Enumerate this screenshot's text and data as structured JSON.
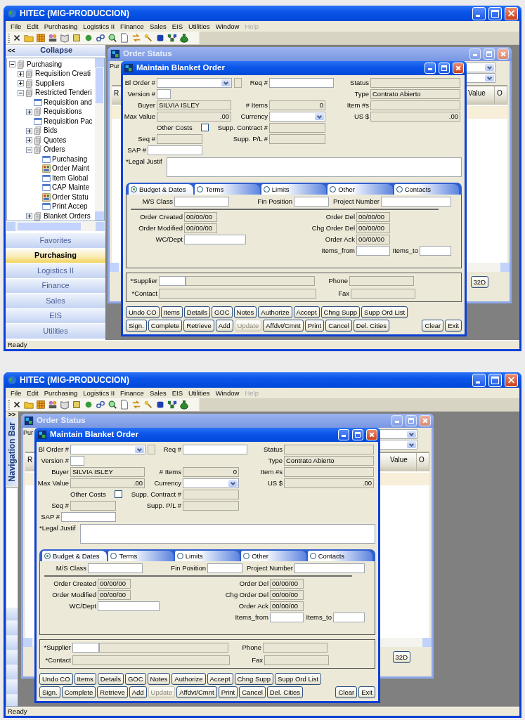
{
  "screenshots": [
    {
      "window": {
        "title": "HITEC  (MIG-PRODUCCION)"
      },
      "menu": [
        {
          "label": "File",
          "disabled": false
        },
        {
          "label": "Edit",
          "disabled": false
        },
        {
          "label": "Purchasing",
          "disabled": false
        },
        {
          "label": "Logistics II",
          "disabled": false
        },
        {
          "label": "Finance",
          "disabled": false
        },
        {
          "label": "Sales",
          "disabled": false
        },
        {
          "label": "EIS",
          "disabled": false
        },
        {
          "label": "Utilities",
          "disabled": false
        },
        {
          "label": "Window",
          "disabled": false
        },
        {
          "label": "Help",
          "disabled": true
        }
      ],
      "sidebar": {
        "collapsed": false,
        "toggle": "<<",
        "title": "Collapse",
        "tree": [
          {
            "label": "Purchasing",
            "kind": "folder",
            "expanded": true,
            "children": [
              {
                "label": "Requisition Creati",
                "kind": "folder",
                "expanded": false
              },
              {
                "label": "Suppliers",
                "kind": "folder",
                "expanded": false
              },
              {
                "label": "Restricted Tenderi",
                "kind": "folder",
                "expanded": true,
                "children": [
                  {
                    "label": "Requisition and",
                    "kind": "form"
                  },
                  {
                    "label": "Requisitions",
                    "kind": "folder",
                    "expanded": false
                  },
                  {
                    "label": "Requisition Pac",
                    "kind": "form"
                  },
                  {
                    "label": "Bids",
                    "kind": "folder",
                    "expanded": false
                  },
                  {
                    "label": "Quotes",
                    "kind": "folder",
                    "expanded": false
                  },
                  {
                    "label": "Orders",
                    "kind": "folder",
                    "expanded": true,
                    "children": [
                      {
                        "label": "Purchasing",
                        "kind": "form"
                      },
                      {
                        "label": "Order Maint",
                        "kind": "report"
                      },
                      {
                        "label": "Item Global",
                        "kind": "form"
                      },
                      {
                        "label": "CAP Mainte",
                        "kind": "form"
                      },
                      {
                        "label": "Order Statu",
                        "kind": "report"
                      },
                      {
                        "label": "Print Accep",
                        "kind": "form"
                      }
                    ]
                  },
                  {
                    "label": "Blanket Orders",
                    "kind": "folder",
                    "expanded": false
                  }
                ]
              }
            ]
          }
        ],
        "nav_buttons": [
          {
            "label": "Favorites",
            "selected": false
          },
          {
            "label": "Purchasing",
            "selected": true
          },
          {
            "label": "Logistics II",
            "selected": false
          },
          {
            "label": "Finance",
            "selected": false
          },
          {
            "label": "Sales",
            "selected": false
          },
          {
            "label": "EIS",
            "selected": false
          },
          {
            "label": "Utilities",
            "selected": false
          }
        ]
      },
      "order_status": {
        "title": "Order Status",
        "filter_label": "Pur",
        "columns": [
          "R",
          "Value",
          "O"
        ],
        "button": "32D"
      },
      "dialog": {
        "title": "Maintain Blanket Order",
        "fields": [
          {
            "label": "Bl Order #",
            "kind": "dropdown"
          },
          {
            "label": "Req #",
            "kind": "input"
          },
          {
            "label": "Status",
            "kind": "readonly"
          },
          {
            "label": "Version #",
            "kind": "input"
          },
          {
            "label": "Type",
            "kind": "readonly",
            "value": "Contrato Abierto"
          },
          {
            "label": "Buyer",
            "kind": "readonly",
            "value": "SILVIA  ISLEY"
          },
          {
            "label": "# Items",
            "kind": "number",
            "value": "0"
          },
          {
            "label": "Item #s",
            "kind": "readonly"
          },
          {
            "label": "Max Value",
            "kind": "number",
            "value": ".00"
          },
          {
            "label": "Currency",
            "kind": "dropdown"
          },
          {
            "label": "US $",
            "kind": "number",
            "value": ".00"
          },
          {
            "label": "Other Costs",
            "kind": "checkbox",
            "checked": false
          },
          {
            "label": "Supp. Contract #",
            "kind": "readonly"
          },
          {
            "label": "Seq #",
            "kind": "readonly"
          },
          {
            "label": "Supp. P/L #",
            "kind": "readonly"
          },
          {
            "label": "SAP #",
            "kind": "input"
          },
          {
            "label": "*Legal Justif",
            "kind": "textarea"
          }
        ],
        "tabs": [
          {
            "label": "Budget & Dates",
            "selected": true
          },
          {
            "label": "Terms",
            "selected": false
          },
          {
            "label": "Limits",
            "selected": false
          },
          {
            "label": "Other",
            "selected": false
          },
          {
            "label": "Contacts",
            "selected": false
          }
        ],
        "tab_fields": [
          {
            "label": "M/S Class",
            "kind": "input"
          },
          {
            "label": "Fin Position",
            "kind": "input"
          },
          {
            "label": "Project Number",
            "kind": "input"
          },
          {
            "label": "Order Created",
            "kind": "readonly",
            "value": "00/00/00"
          },
          {
            "label": "Order Del",
            "kind": "readonly",
            "value": "00/00/00"
          },
          {
            "label": "Order Modified",
            "kind": "readonly",
            "value": "00/00/00"
          },
          {
            "label": "Chg Order Del",
            "kind": "readonly",
            "value": "00/00/00"
          },
          {
            "label": "WC/Dept",
            "kind": "input"
          },
          {
            "label": "Order Ack",
            "kind": "readonly",
            "value": "00/00/00"
          },
          {
            "label": "Items_from",
            "kind": "input"
          },
          {
            "label": "Items_to",
            "kind": "input"
          }
        ],
        "supplier_fields": [
          {
            "label": "*Supplier",
            "kind": "lookup"
          },
          {
            "label": "Phone",
            "kind": "readonly"
          },
          {
            "label": "*Contact",
            "kind": "readonly"
          },
          {
            "label": "Fax",
            "kind": "readonly"
          }
        ],
        "button_rows": [
          [
            {
              "label": "Undo CO",
              "disabled": false
            },
            {
              "label": "Items",
              "disabled": false
            },
            {
              "label": "Details",
              "disabled": false
            },
            {
              "label": "GOC",
              "disabled": false
            },
            {
              "label": "Notes",
              "disabled": false
            },
            {
              "label": "Authorize",
              "disabled": false
            },
            {
              "label": "Accept",
              "disabled": false
            },
            {
              "label": "Chng Supp",
              "disabled": false
            },
            {
              "label": "Supp Ord List",
              "disabled": false
            }
          ],
          [
            {
              "label": "Sign.",
              "disabled": false
            },
            {
              "label": "Complete",
              "disabled": false
            },
            {
              "label": "Retrieve",
              "disabled": false
            },
            {
              "label": "Add",
              "disabled": false
            },
            {
              "label": "Update",
              "disabled": true
            },
            {
              "label": "Affdvt/Cmnt",
              "disabled": false
            },
            {
              "label": "Print",
              "disabled": false
            },
            {
              "label": "Cancel",
              "disabled": false
            },
            {
              "label": "Del. Cities",
              "disabled": false
            }
          ]
        ],
        "end_buttons": [
          {
            "label": "Clear",
            "disabled": false
          },
          {
            "label": "Exit",
            "disabled": false
          }
        ]
      },
      "status_bar": "Ready"
    },
    {
      "window": {
        "title": "HITEC  (MIG-PRODUCCION)"
      },
      "menu": [
        {
          "label": "File",
          "disabled": false
        },
        {
          "label": "Edit",
          "disabled": false
        },
        {
          "label": "Purchasing",
          "disabled": false
        },
        {
          "label": "Logistics II",
          "disabled": false
        },
        {
          "label": "Finance",
          "disabled": false
        },
        {
          "label": "Sales",
          "disabled": false
        },
        {
          "label": "EIS",
          "disabled": false
        },
        {
          "label": "Utilities",
          "disabled": false
        },
        {
          "label": "Window",
          "disabled": false
        },
        {
          "label": "Help",
          "disabled": true
        }
      ],
      "sidebar": {
        "collapsed": true,
        "toggle": ">>",
        "title": "Navigation Bar"
      },
      "order_status": {
        "title": "Order Status",
        "filter_label": "Pur",
        "columns": [
          "R",
          "Value",
          "O"
        ],
        "button": "32D"
      },
      "dialog": {
        "title": "Maintain Blanket Order",
        "fields": [
          {
            "label": "Bl Order #",
            "kind": "dropdown"
          },
          {
            "label": "Req #",
            "kind": "input"
          },
          {
            "label": "Status",
            "kind": "readonly"
          },
          {
            "label": "Version #",
            "kind": "input"
          },
          {
            "label": "Type",
            "kind": "readonly",
            "value": "Contrato Abierto"
          },
          {
            "label": "Buyer",
            "kind": "readonly",
            "value": "SILVIA  ISLEY"
          },
          {
            "label": "# Items",
            "kind": "number",
            "value": "0"
          },
          {
            "label": "Item #s",
            "kind": "readonly"
          },
          {
            "label": "Max Value",
            "kind": "number",
            "value": ".00"
          },
          {
            "label": "Currency",
            "kind": "dropdown"
          },
          {
            "label": "US $",
            "kind": "number",
            "value": ".00"
          },
          {
            "label": "Other Costs",
            "kind": "checkbox",
            "checked": false
          },
          {
            "label": "Supp. Contract #",
            "kind": "readonly"
          },
          {
            "label": "Seq #",
            "kind": "readonly"
          },
          {
            "label": "Supp. P/L #",
            "kind": "readonly"
          },
          {
            "label": "SAP #",
            "kind": "input"
          },
          {
            "label": "*Legal Justif",
            "kind": "textarea"
          }
        ],
        "tabs": [
          {
            "label": "Budget & Dates",
            "selected": true
          },
          {
            "label": "Terms",
            "selected": false
          },
          {
            "label": "Limits",
            "selected": false
          },
          {
            "label": "Other",
            "selected": false
          },
          {
            "label": "Contacts",
            "selected": false
          }
        ],
        "tab_fields": [
          {
            "label": "M/S Class",
            "kind": "input"
          },
          {
            "label": "Fin Position",
            "kind": "input"
          },
          {
            "label": "Project Number",
            "kind": "input"
          },
          {
            "label": "Order Created",
            "kind": "readonly",
            "value": "00/00/00"
          },
          {
            "label": "Order Del",
            "kind": "readonly",
            "value": "00/00/00"
          },
          {
            "label": "Order Modified",
            "kind": "readonly",
            "value": "00/00/00"
          },
          {
            "label": "Chg Order Del",
            "kind": "readonly",
            "value": "00/00/00"
          },
          {
            "label": "WC/Dept",
            "kind": "input"
          },
          {
            "label": "Order Ack",
            "kind": "readonly",
            "value": "00/00/00"
          },
          {
            "label": "Items_from",
            "kind": "input"
          },
          {
            "label": "Items_to",
            "kind": "input"
          }
        ],
        "supplier_fields": [
          {
            "label": "*Supplier",
            "kind": "lookup"
          },
          {
            "label": "Phone",
            "kind": "readonly"
          },
          {
            "label": "*Contact",
            "kind": "readonly"
          },
          {
            "label": "Fax",
            "kind": "readonly"
          }
        ],
        "button_rows": [
          [
            {
              "label": "Undo CO",
              "disabled": false
            },
            {
              "label": "Items",
              "disabled": false
            },
            {
              "label": "Details",
              "disabled": false
            },
            {
              "label": "GOC",
              "disabled": false
            },
            {
              "label": "Notes",
              "disabled": false
            },
            {
              "label": "Authorize",
              "disabled": false
            },
            {
              "label": "Accept",
              "disabled": false
            },
            {
              "label": "Chng Supp",
              "disabled": false
            },
            {
              "label": "Supp Ord List",
              "disabled": false
            }
          ],
          [
            {
              "label": "Sign.",
              "disabled": false
            },
            {
              "label": "Complete",
              "disabled": false
            },
            {
              "label": "Retrieve",
              "disabled": false
            },
            {
              "label": "Add",
              "disabled": false
            },
            {
              "label": "Update",
              "disabled": true
            },
            {
              "label": "Affdvt/Cmnt",
              "disabled": false
            },
            {
              "label": "Print",
              "disabled": false
            },
            {
              "label": "Cancel",
              "disabled": false
            },
            {
              "label": "Del. Cities",
              "disabled": false
            }
          ]
        ],
        "end_buttons": [
          {
            "label": "Clear",
            "disabled": false
          },
          {
            "label": "Exit",
            "disabled": false
          }
        ]
      },
      "status_bar": "Ready"
    }
  ]
}
